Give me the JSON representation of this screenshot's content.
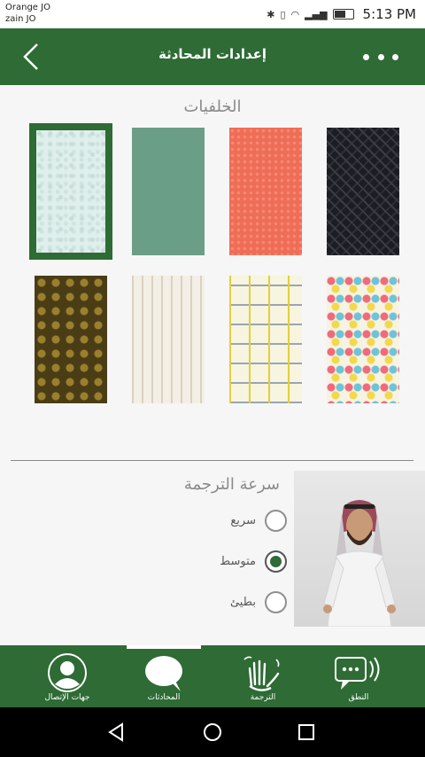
{
  "status_bar": {
    "carrier_1": "Orange JO",
    "carrier_2": "zain JO",
    "time": "5:13 PM",
    "icons": [
      "bluetooth-icon",
      "vibrate-icon",
      "wifi-icon",
      "signal-icon",
      "battery-icon"
    ]
  },
  "header": {
    "title": "إعدادات المحادثة",
    "back_icon": "chevron-left-icon",
    "more_icon": "more-dots-icon"
  },
  "backgrounds": {
    "title": "الخلفيات",
    "selected_index": 0,
    "items": [
      {
        "name": "light-floral",
        "color": "#dff0ec"
      },
      {
        "name": "sage-green",
        "color": "#6a9e86"
      },
      {
        "name": "coral-texture",
        "color": "#ef6d57"
      },
      {
        "name": "dark-geometric",
        "color": "#1c1d22"
      },
      {
        "name": "olive-circles",
        "color": "#5b4b1c"
      },
      {
        "name": "cream-stripes",
        "color": "#f3efe6"
      },
      {
        "name": "maze-lines",
        "color": "#f7f4df"
      },
      {
        "name": "colorful-fans",
        "color": "#f6f3e2"
      }
    ]
  },
  "translation_speed": {
    "title": "سرعة الترجمة",
    "options": [
      {
        "label": "سريع",
        "checked": false
      },
      {
        "label": "متوسط",
        "checked": true
      },
      {
        "label": "بطيئ",
        "checked": false
      }
    ]
  },
  "bottom_nav": {
    "active_index": 1,
    "items": [
      {
        "label": "جهات الإتصال",
        "icon": "contacts-icon"
      },
      {
        "label": "المحادثات",
        "icon": "chat-bubble-icon"
      },
      {
        "label": "الترجمة",
        "icon": "sign-language-icon"
      },
      {
        "label": "النطق",
        "icon": "speech-icon"
      }
    ]
  },
  "colors": {
    "primary": "#2e6b35",
    "section_title": "#8a8a8a"
  }
}
